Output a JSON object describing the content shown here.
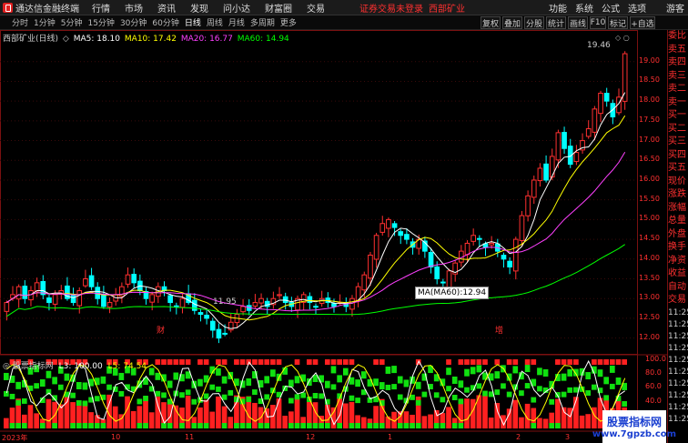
{
  "app": {
    "name": "通达信金融终端",
    "menu": [
      "行情",
      "市场",
      "资讯",
      "发现",
      "问小达",
      "财富圈",
      "交易"
    ],
    "warning": "证券交易未登录",
    "stock_name": "西部矿业",
    "right_menu": [
      "功能",
      "系统",
      "公式",
      "选项",
      "游客"
    ]
  },
  "toolbar": {
    "timeframes": [
      "分时",
      "1分钟",
      "5分钟",
      "15分钟",
      "30分钟",
      "60分钟",
      "日线",
      "周线",
      "月线",
      "多周期",
      "更多"
    ],
    "active": "日线",
    "buttons": [
      "复权",
      "叠加",
      "分股",
      "统计",
      "画线",
      "F10",
      "标记",
      "+自选"
    ]
  },
  "chart_legend": {
    "title": "西部矿业(日线)",
    "ma5": "MA5: 18.10",
    "ma10": "MA10: 17.42",
    "ma20": "MA20: 16.77",
    "ma60": "MA60: 14.94",
    "colors": {
      "ma5": "#ffffff",
      "ma10": "#ffff00",
      "ma20": "#ff40ff",
      "ma60": "#00ff00"
    }
  },
  "price_axis": [
    "19.00",
    "18.50",
    "18.00",
    "17.50",
    "17.00",
    "16.50",
    "16.00",
    "15.50",
    "15.00",
    "14.50",
    "14.00",
    "13.50",
    "13.00",
    "12.50",
    "12.00"
  ],
  "annotations": {
    "high_label": "19.46",
    "low_label": "11.95",
    "tooltip": "MA(MA60):12.94",
    "marker_left": "财",
    "marker_right": "增"
  },
  "indicator": {
    "name": "股票指标网",
    "l3": "L3: 100.00",
    "l5": "L5: 74.54",
    "axis": [
      "100.0",
      "80.0",
      "60.0",
      "40.0",
      "20.0",
      "0.0"
    ]
  },
  "dates": [
    "2023年",
    "10",
    "11",
    "12",
    "1",
    "2",
    "3"
  ],
  "side_panel": {
    "items": [
      "委比",
      "卖五",
      "卖四",
      "卖三",
      "卖二",
      "卖一",
      "买一",
      "买二",
      "买三",
      "买四",
      "买五",
      "现价",
      "涨跌",
      "涨幅",
      "总量",
      "外盘",
      "换手",
      "净资",
      "收益",
      "自动",
      "交易"
    ],
    "times": [
      "11:25",
      "11:25",
      "11:25",
      "11:25",
      "11:25",
      "11:25",
      "11:25",
      "11:25",
      "11:25",
      "11:25"
    ]
  },
  "watermark": {
    "line1": "股票指标网",
    "line2": "www.7gpzb.com"
  },
  "chart_data": {
    "type": "candlestick",
    "title": "西部矿业(日线)",
    "ylim": [
      11.6,
      19.8
    ],
    "close": [
      12.9,
      13.1,
      13.3,
      13.0,
      13.2,
      13.4,
      13.1,
      12.9,
      13.1,
      13.2,
      13.0,
      12.9,
      13.2,
      13.5,
      13.3,
      13.0,
      12.8,
      12.9,
      13.1,
      13.3,
      13.6,
      13.4,
      13.2,
      13.0,
      13.1,
      13.3,
      13.2,
      12.9,
      12.8,
      13.0,
      12.9,
      12.7,
      12.6,
      12.5,
      12.2,
      12.0,
      12.1,
      12.4,
      12.6,
      12.8,
      12.7,
      12.9,
      13.0,
      12.8,
      13.0,
      13.1,
      12.9,
      12.8,
      13.0,
      13.1,
      12.9,
      12.8,
      13.0,
      12.9,
      12.8,
      12.9,
      12.8,
      13.0,
      13.3,
      13.6,
      14.1,
      14.6,
      14.9,
      15.0,
      14.8,
      14.6,
      14.5,
      14.3,
      14.5,
      14.2,
      13.8,
      13.5,
      13.4,
      13.7,
      13.9,
      14.2,
      14.4,
      14.6,
      14.5,
      14.3,
      14.4,
      14.2,
      14.0,
      13.8,
      14.5,
      15.1,
      15.6,
      16.0,
      16.3,
      16.0,
      16.6,
      17.2,
      16.8,
      16.4,
      16.7,
      17.0,
      17.3,
      17.8,
      18.2,
      18.0,
      17.6,
      18.1,
      19.2
    ],
    "ma60_last": 12.94,
    "indicator_l3": 100.0,
    "indicator_l5": 74.54
  }
}
